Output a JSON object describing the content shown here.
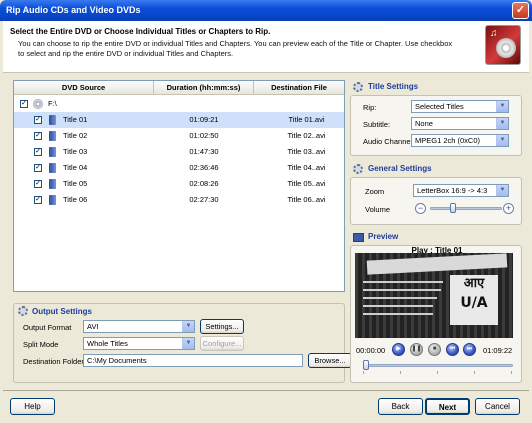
{
  "window": {
    "title": "Rip Audio CDs and Video DVDs",
    "close_glyph": "✕"
  },
  "header": {
    "heading": "Select the Entire DVD or Choose Individual Titles or Chapters to Rip.",
    "description": "You can choose to rip the entire DVD or individual Titles and Chapters. You can preview each of the Title or Chapter. Use checkbox to select and rip the entire DVD or individual Titles and Chapters."
  },
  "table": {
    "columns": [
      "DVD Source",
      "Duration (hh:mm:ss)",
      "Destination File"
    ],
    "root": {
      "label": "F:\\",
      "checked": true
    },
    "rows": [
      {
        "title": "Title 01",
        "duration": "01:09:21",
        "dest": "Title 01.avi",
        "checked": true,
        "selected": true
      },
      {
        "title": "Title 02",
        "duration": "01:02:50",
        "dest": "Title 02..avi",
        "checked": true,
        "selected": false
      },
      {
        "title": "Title 03",
        "duration": "01:47:30",
        "dest": "Title 03..avi",
        "checked": true,
        "selected": false
      },
      {
        "title": "Title 04",
        "duration": "02:36:46",
        "dest": "Title 04..avi",
        "checked": true,
        "selected": false
      },
      {
        "title": "Title 05",
        "duration": "02:08:26",
        "dest": "Title 05..avi",
        "checked": true,
        "selected": false
      },
      {
        "title": "Title 06",
        "duration": "02:27:30",
        "dest": "Title 06..avi",
        "checked": true,
        "selected": false
      }
    ]
  },
  "output": {
    "title": "Output Settings",
    "format_label": "Output Format",
    "format_value": "AVI",
    "settings_button": "Settings...",
    "split_label": "Split Mode",
    "split_value": "Whole Titles",
    "configure_button": "Configure...",
    "folder_label": "Destination Folder",
    "folder_value": "C:\\My Documents",
    "browse_button": "Browse..."
  },
  "title_settings": {
    "title": "Title Settings",
    "rip_label": "Rip:",
    "rip_value": "Selected Titles",
    "subtitle_label": "Subtitle:",
    "subtitle_value": "None",
    "audio_label": "Audio Channel:",
    "audio_value": "MPEG1 2ch (0xC0)"
  },
  "general_settings": {
    "title": "General Settings",
    "zoom_label": "Zoom",
    "zoom_value": "LetterBox 16:9 -> 4:3",
    "volume_label": "Volume",
    "volume_level": 0.3
  },
  "preview": {
    "title": "Preview",
    "playing": "Play : Title 01",
    "time_start": "00:00:00",
    "time_end": "01:09:22",
    "overlay_text": "आए",
    "overlay_sub": "U/A",
    "seek_position": 0.0
  },
  "buttons": {
    "help": "Help",
    "back": "Back",
    "next": "Next",
    "cancel": "Cancel"
  },
  "icons": {
    "drop_arrow": "▼",
    "check": "✓",
    "minus": "−",
    "plus": "+",
    "play": "▶",
    "pause": "❚❚",
    "stop": "■",
    "prev": "⏮",
    "next_ch": "⏭",
    "note": "♫"
  },
  "colors": {
    "accent": "#1f3d9d",
    "selection": "#cfe0fb",
    "titlebar": "#0a4ed8"
  }
}
